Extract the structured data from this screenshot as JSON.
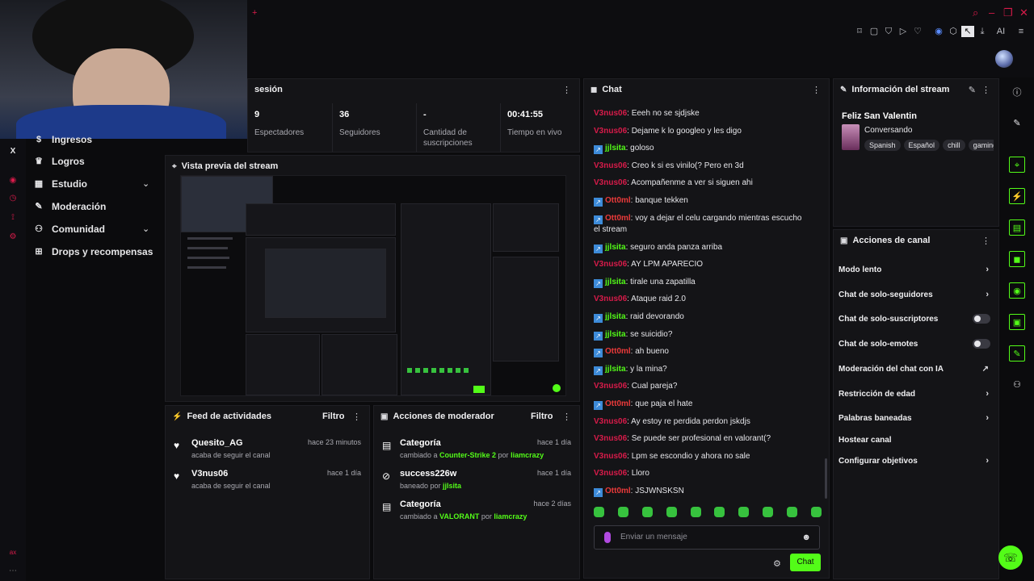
{
  "titlebar": {
    "tab_plus": "+",
    "toolbar_ai": "AI"
  },
  "sidebar": {
    "items": [
      {
        "label": "Ingresos",
        "icon": "dollar-icon"
      },
      {
        "label": "Logros",
        "icon": "trophy-icon"
      },
      {
        "label": "Estudio",
        "icon": "studio-icon"
      },
      {
        "label": "Moderación",
        "icon": "wrench-icon"
      },
      {
        "label": "Comunidad",
        "icon": "community-icon"
      },
      {
        "label": "Drops y recompensas",
        "icon": "gift-icon"
      }
    ],
    "x_label": "X",
    "ax_label": "ax"
  },
  "stats": {
    "title": "sesión",
    "items": [
      {
        "value": "9",
        "label": "Espectadores"
      },
      {
        "value": "36",
        "label": "Seguidores"
      },
      {
        "value": "-",
        "label": "Cantidad de suscripciones"
      },
      {
        "value": "00:41:55",
        "label": "Tiempo en vivo"
      }
    ]
  },
  "preview": {
    "title": "Vista previa del stream"
  },
  "feed": {
    "title": "Feed de actividades",
    "filter": "Filtro",
    "items": [
      {
        "name": "Quesito_AG",
        "sub": "acaba de seguir el canal",
        "time": "hace 23 minutos"
      },
      {
        "name": "V3nus06",
        "sub": "acaba de seguir el canal",
        "time": "hace 1 día"
      }
    ]
  },
  "mod_actions": {
    "title": "Acciones de moderador",
    "filter": "Filtro",
    "items": [
      {
        "name": "Categoría",
        "pre": "cambiado a ",
        "target": "Counter-Strike 2",
        "mid": " por ",
        "by": "liamcrazy",
        "time": "hace 1 día"
      },
      {
        "name": "success226w",
        "pre": "baneado por ",
        "target": "jjlsita",
        "mid": "",
        "by": "",
        "time": "hace 1 día"
      },
      {
        "name": "Categoría",
        "pre": "cambiado a ",
        "target": "VALORANT",
        "mid": " por ",
        "by": "liamcrazy",
        "time": "hace 2 días"
      }
    ]
  },
  "chat": {
    "title": "Chat",
    "messages": [
      {
        "user": "V3nus06",
        "cls": "u1",
        "badge": false,
        "text": ": Eeeh no se sjdjske"
      },
      {
        "user": "V3nus06",
        "cls": "u1",
        "badge": false,
        "text": ": Dejame k lo googleo y les digo"
      },
      {
        "user": "jjlsita",
        "cls": "u2",
        "badge": true,
        "text": ": goloso"
      },
      {
        "user": "V3nus06",
        "cls": "u1",
        "badge": false,
        "text": ": Creo k si es vinilo(? Pero en 3d"
      },
      {
        "user": "V3nus06",
        "cls": "u1",
        "badge": false,
        "text": ": Acompañenme a ver si siguen ahi"
      },
      {
        "user": "Ott0ml",
        "cls": "u3",
        "badge": true,
        "text": ": banque tekken"
      },
      {
        "user": "Ott0ml",
        "cls": "u3",
        "badge": true,
        "text": ": voy a dejar el celu cargando mientras escucho el stream"
      },
      {
        "user": "jjlsita",
        "cls": "u2",
        "badge": true,
        "text": ": seguro anda panza arriba"
      },
      {
        "user": "V3nus06",
        "cls": "u1",
        "badge": false,
        "text": ": AY LPM APARECIO"
      },
      {
        "user": "jjlsita",
        "cls": "u2",
        "badge": true,
        "text": ": tirale una zapatilla"
      },
      {
        "user": "V3nus06",
        "cls": "u1",
        "badge": false,
        "text": ": Ataque raid 2.0"
      },
      {
        "user": "jjlsita",
        "cls": "u2",
        "badge": true,
        "text": ": raid devorando"
      },
      {
        "user": "jjlsita",
        "cls": "u2",
        "badge": true,
        "text": ": se suicidio?"
      },
      {
        "user": "Ott0ml",
        "cls": "u3",
        "badge": true,
        "text": ": ah bueno"
      },
      {
        "user": "jjlsita",
        "cls": "u2",
        "badge": true,
        "text": ": y la mina?"
      },
      {
        "user": "V3nus06",
        "cls": "u1",
        "badge": false,
        "text": ": Cual pareja?"
      },
      {
        "user": "Ott0ml",
        "cls": "u3",
        "badge": true,
        "text": ": que paja el hate"
      },
      {
        "user": "V3nus06",
        "cls": "u1",
        "badge": false,
        "text": ": Ay estoy re perdida perdon jskdjs"
      },
      {
        "user": "V3nus06",
        "cls": "u1",
        "badge": false,
        "text": ": Se puede ser profesional en valorant(?"
      },
      {
        "user": "V3nus06",
        "cls": "u1",
        "badge": false,
        "text": ": Lpm se escondio y ahora no sale"
      },
      {
        "user": "V3nus06",
        "cls": "u1",
        "badge": false,
        "text": ": Lloro"
      },
      {
        "user": "Ott0ml",
        "cls": "u3",
        "badge": true,
        "text": ": JSJWNSKSN"
      }
    ],
    "input_placeholder": "Enviar un mensaje",
    "send_label": "Chat"
  },
  "stream_info": {
    "title": "Información del stream",
    "stream_title": "Feliz San Valentin",
    "category": "Conversando",
    "tags": [
      "Spanish",
      "Español",
      "chill",
      "gaming"
    ]
  },
  "channel_actions": {
    "title": "Acciones de canal",
    "items": [
      {
        "label": "Modo lento",
        "control": "chevron"
      },
      {
        "label": "Chat de solo-seguidores",
        "control": "chevron"
      },
      {
        "label": "Chat de solo-suscriptores",
        "control": "toggle"
      },
      {
        "label": "Chat de solo-emotes",
        "control": "toggle"
      },
      {
        "label": "Moderación del chat con IA",
        "control": "external"
      },
      {
        "label": "Restricción de edad",
        "control": "chevron"
      },
      {
        "label": "Palabras baneadas",
        "control": "chevron"
      },
      {
        "label": "Hostear canal",
        "control": "none"
      },
      {
        "label": "Configurar objetivos",
        "control": "chevron"
      }
    ]
  },
  "colors": {
    "accent": "#53fc18",
    "brand_red": "#d81b4a",
    "panel": "#141417"
  }
}
